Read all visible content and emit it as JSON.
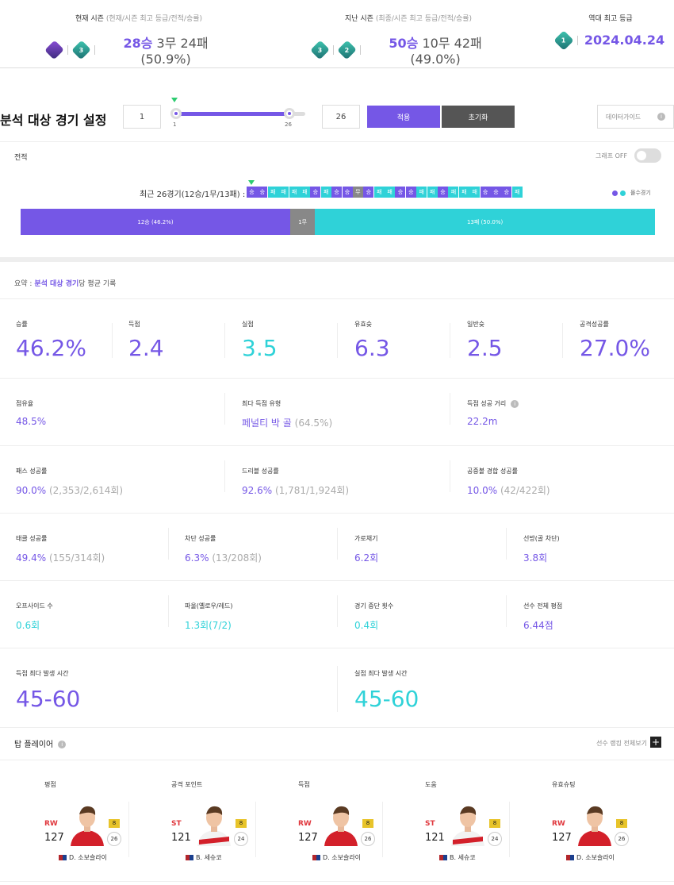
{
  "header": {
    "current": {
      "title": "현재 시즌",
      "sub": "(현재/시즌 최고 등급/전적/승률)",
      "rank_a": "",
      "rank_b": "3",
      "wins": "28승",
      "rest": "3무 24패(50.9%)"
    },
    "previous": {
      "title": "지난 시즌",
      "sub": "(최종/시즌 최고 등급/전적/승률)",
      "rank_a": "3",
      "rank_b": "2",
      "wins": "50승",
      "rest": "10무 42패(49.0%)"
    },
    "best": {
      "title": "역대 최고 등급",
      "rank": "1",
      "date": "2024.04.24"
    }
  },
  "settings": {
    "title": "분석 대상 경기 설정",
    "from": "1",
    "to": "26",
    "min_label": "1",
    "max_label": "26",
    "apply": "적용",
    "reset": "초기화",
    "guide": "데이터가이드",
    "slider_fill_fraction": 0.88
  },
  "record": {
    "label": "전적",
    "graph_toggle": "그래프 OFF",
    "recent_label": "최근 26경기(12승/1무/13패) :",
    "legend": "몰수경기",
    "results": [
      "승",
      "승",
      "패",
      "패",
      "패",
      "패",
      "승",
      "패",
      "승",
      "승",
      "무",
      "승",
      "패",
      "패",
      "승",
      "승",
      "패",
      "패",
      "승",
      "패",
      "패",
      "패",
      "승",
      "승",
      "승",
      "패"
    ],
    "dot_index": [
      2,
      3,
      4,
      5,
      12,
      19,
      23
    ],
    "wins_bar": "12승 (46.2%)",
    "draws_bar": "1무",
    "losses_bar": "13패 (50.0%)",
    "wins": 12,
    "draws": 1,
    "losses": 13
  },
  "summary": {
    "prefix": "요약 : ",
    "highlight": "분석 대상 경기",
    "suffix": "당 평균 기록",
    "row1": [
      {
        "k": "승률",
        "v": "46.2%",
        "c": "purple"
      },
      {
        "k": "득점",
        "v": "2.4",
        "c": "purple"
      },
      {
        "k": "실점",
        "v": "3.5",
        "c": "teal"
      },
      {
        "k": "유효슛",
        "v": "6.3",
        "c": "purple"
      },
      {
        "k": "일반슛",
        "v": "2.5",
        "c": "purple"
      },
      {
        "k": "공격성공률",
        "v": "27.0%",
        "c": "purple"
      }
    ],
    "row2": [
      {
        "k": "점유율",
        "v": "48.5%",
        "extra": ""
      },
      {
        "k": "최다 득점 유형",
        "v": "페널티 박 골",
        "extra": " (64.5%)"
      },
      {
        "k": "득점 성공 거리",
        "v": "22.2m",
        "extra": ""
      }
    ],
    "row3": [
      {
        "k": "패스 성공률",
        "v": "90.0%",
        "extra": " (2,353/2,614회)"
      },
      {
        "k": "드리블 성공률",
        "v": "92.6%",
        "extra": " (1,781/1,924회)"
      },
      {
        "k": "공중볼 경합 성공률",
        "v": "10.0%",
        "extra": " (42/422회)"
      }
    ],
    "row4": [
      {
        "k": "태클 성공률",
        "v": "49.4%",
        "extra": " (155/314회)"
      },
      {
        "k": "차단 성공률",
        "v": "6.3%",
        "extra": " (13/208회)"
      },
      {
        "k": "가로채기",
        "v": "6.2회",
        "extra": ""
      },
      {
        "k": "선방(골 차단)",
        "v": "3.8회",
        "extra": ""
      }
    ],
    "row5": [
      {
        "k": "오프사이드 수",
        "v": "0.6회"
      },
      {
        "k": "파울(옐로우/레드)",
        "v": "1.3회(7/2)"
      },
      {
        "k": "경기 중단 횟수",
        "v": "0.4회"
      },
      {
        "k": "선수 전체 평점",
        "v": "6.44점"
      }
    ],
    "row6": [
      {
        "k": "득점 최다 발생 시간",
        "v": "45-60"
      },
      {
        "k": "실점 최다 발생 시간",
        "v": "45-60"
      }
    ]
  },
  "top_players": {
    "title": "탑 플레이어",
    "more": "선수 랭킹 전체보기",
    "cards": [
      {
        "cat": "평점",
        "pos": "RW",
        "ovr": "127",
        "level": "8",
        "num": "26",
        "name": "D. 소보슬라이"
      },
      {
        "cat": "공격 포인트",
        "pos": "ST",
        "ovr": "121",
        "level": "8",
        "num": "24",
        "name": "B. 세슈코"
      },
      {
        "cat": "득점",
        "pos": "RW",
        "ovr": "127",
        "level": "8",
        "num": "26",
        "name": "D. 소보슬라이"
      },
      {
        "cat": "도움",
        "pos": "ST",
        "ovr": "121",
        "level": "8",
        "num": "24",
        "name": "B. 세슈코"
      },
      {
        "cat": "유효슈팅",
        "pos": "RW",
        "ovr": "127",
        "level": "8",
        "num": "26",
        "name": "D. 소보슬라이"
      }
    ]
  }
}
